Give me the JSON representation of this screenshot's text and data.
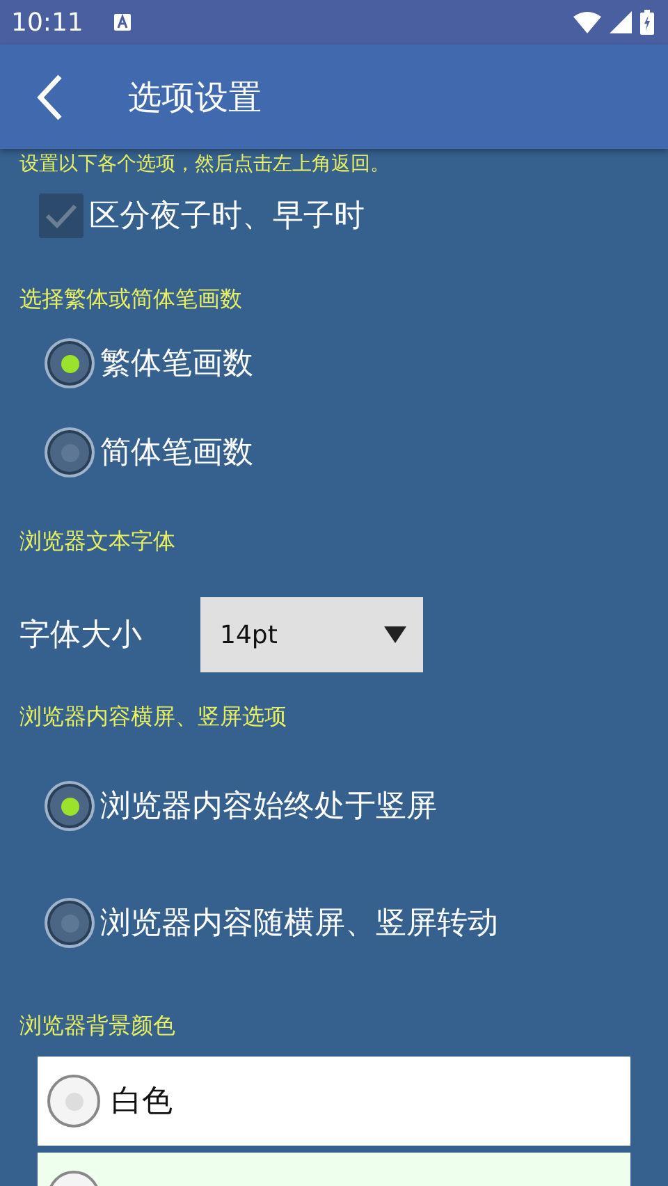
{
  "status_bar": {
    "time": "10:11"
  },
  "toolbar": {
    "title": "选项设置"
  },
  "intro": "设置以下各个选项，然后点击左上角返回。",
  "zi_option": {
    "label": "区分夜子时、早子时",
    "checked": true
  },
  "sections": [
    {
      "kind": "radios",
      "heading": "选择繁体或简体笔画数",
      "options": [
        {
          "label": "繁体笔画数",
          "selected": true
        },
        {
          "label": "简体笔画数",
          "selected": false
        }
      ]
    },
    {
      "kind": "select",
      "heading": "浏览器文本字体",
      "label": "字体大小",
      "value": "14pt"
    },
    {
      "kind": "radios",
      "heading": "浏览器内容横屏、竖屏选项",
      "options": [
        {
          "label": "浏览器内容始终处于竖屏",
          "selected": true
        },
        {
          "label": "浏览器内容随横屏、竖屏转动",
          "selected": false
        }
      ]
    },
    {
      "kind": "colors",
      "heading": "浏览器背景颜色",
      "options": [
        {
          "label": "白色",
          "color": "#ffffff",
          "selected": false
        },
        {
          "color": "#eeffee"
        }
      ]
    }
  ]
}
